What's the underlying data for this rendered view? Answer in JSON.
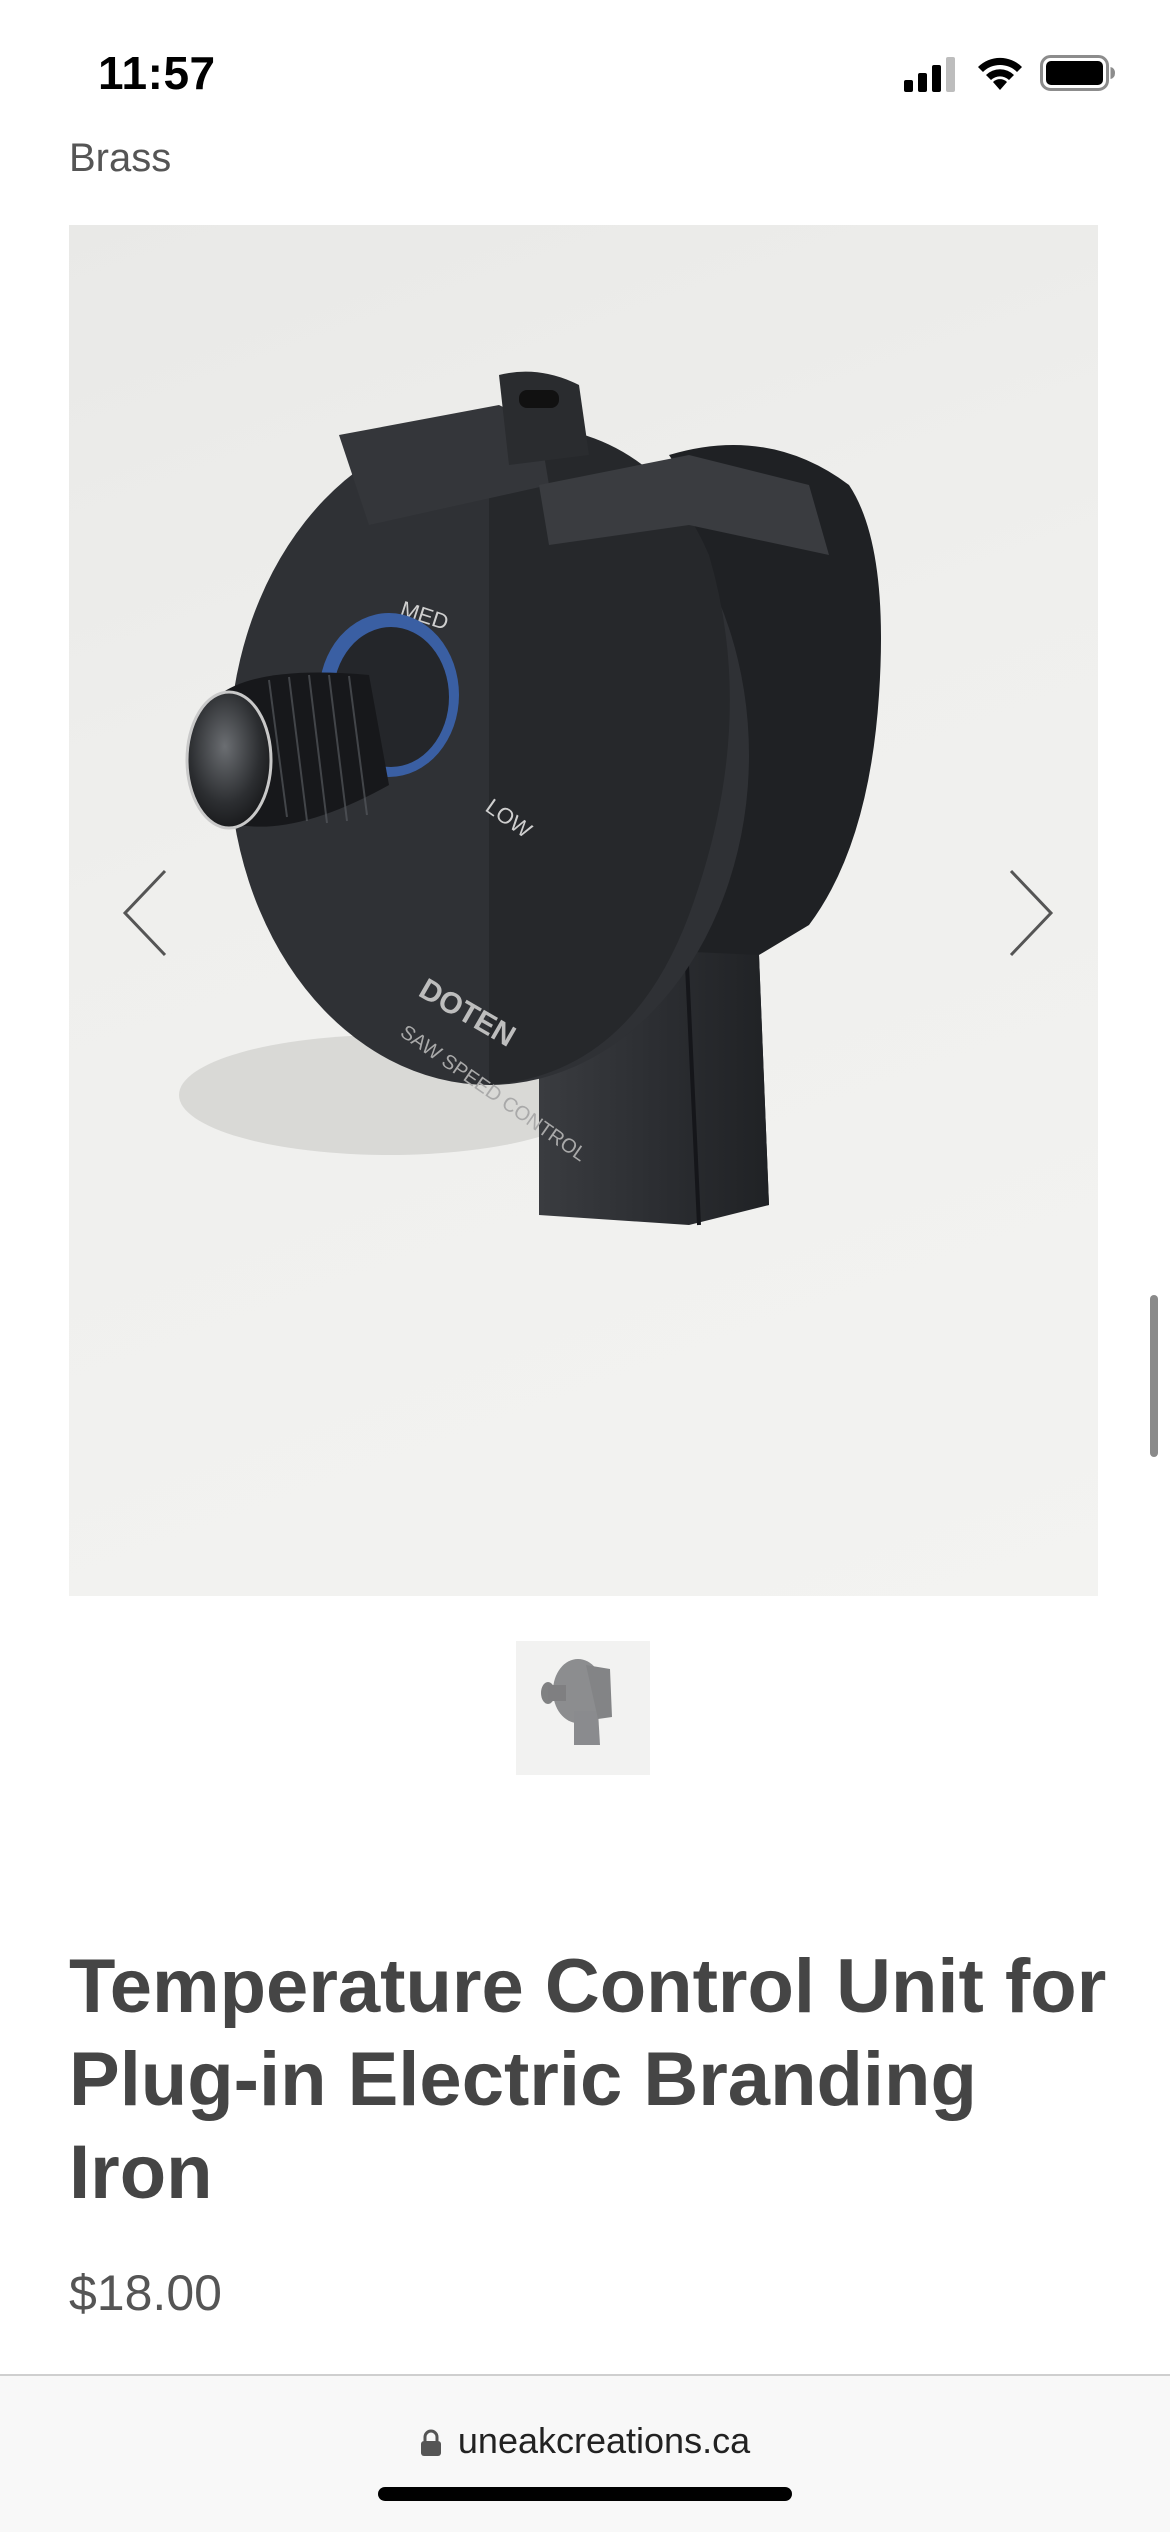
{
  "status_bar": {
    "time": "11:57",
    "icons": [
      "signal-icon",
      "wifi-icon",
      "battery-icon"
    ]
  },
  "breadcrumb": "Brass",
  "product": {
    "image_knob_labels": {
      "med": "MED",
      "low": "LOW",
      "brand": "DOTEN",
      "brand_sub": "SAW SPEED CONTROL"
    },
    "title": "Temperature Control Unit for Plug-in Electric Branding Iron",
    "price": "$18.00"
  },
  "browser": {
    "url": "uneakcreations.ca",
    "icons": [
      "lock-icon"
    ]
  },
  "colors": {
    "text_dark": "#454545",
    "text_muted": "#555555",
    "device_body": "#2b2d30",
    "knob_ring": "#3a5fa3",
    "image_bg": "#efefed"
  }
}
